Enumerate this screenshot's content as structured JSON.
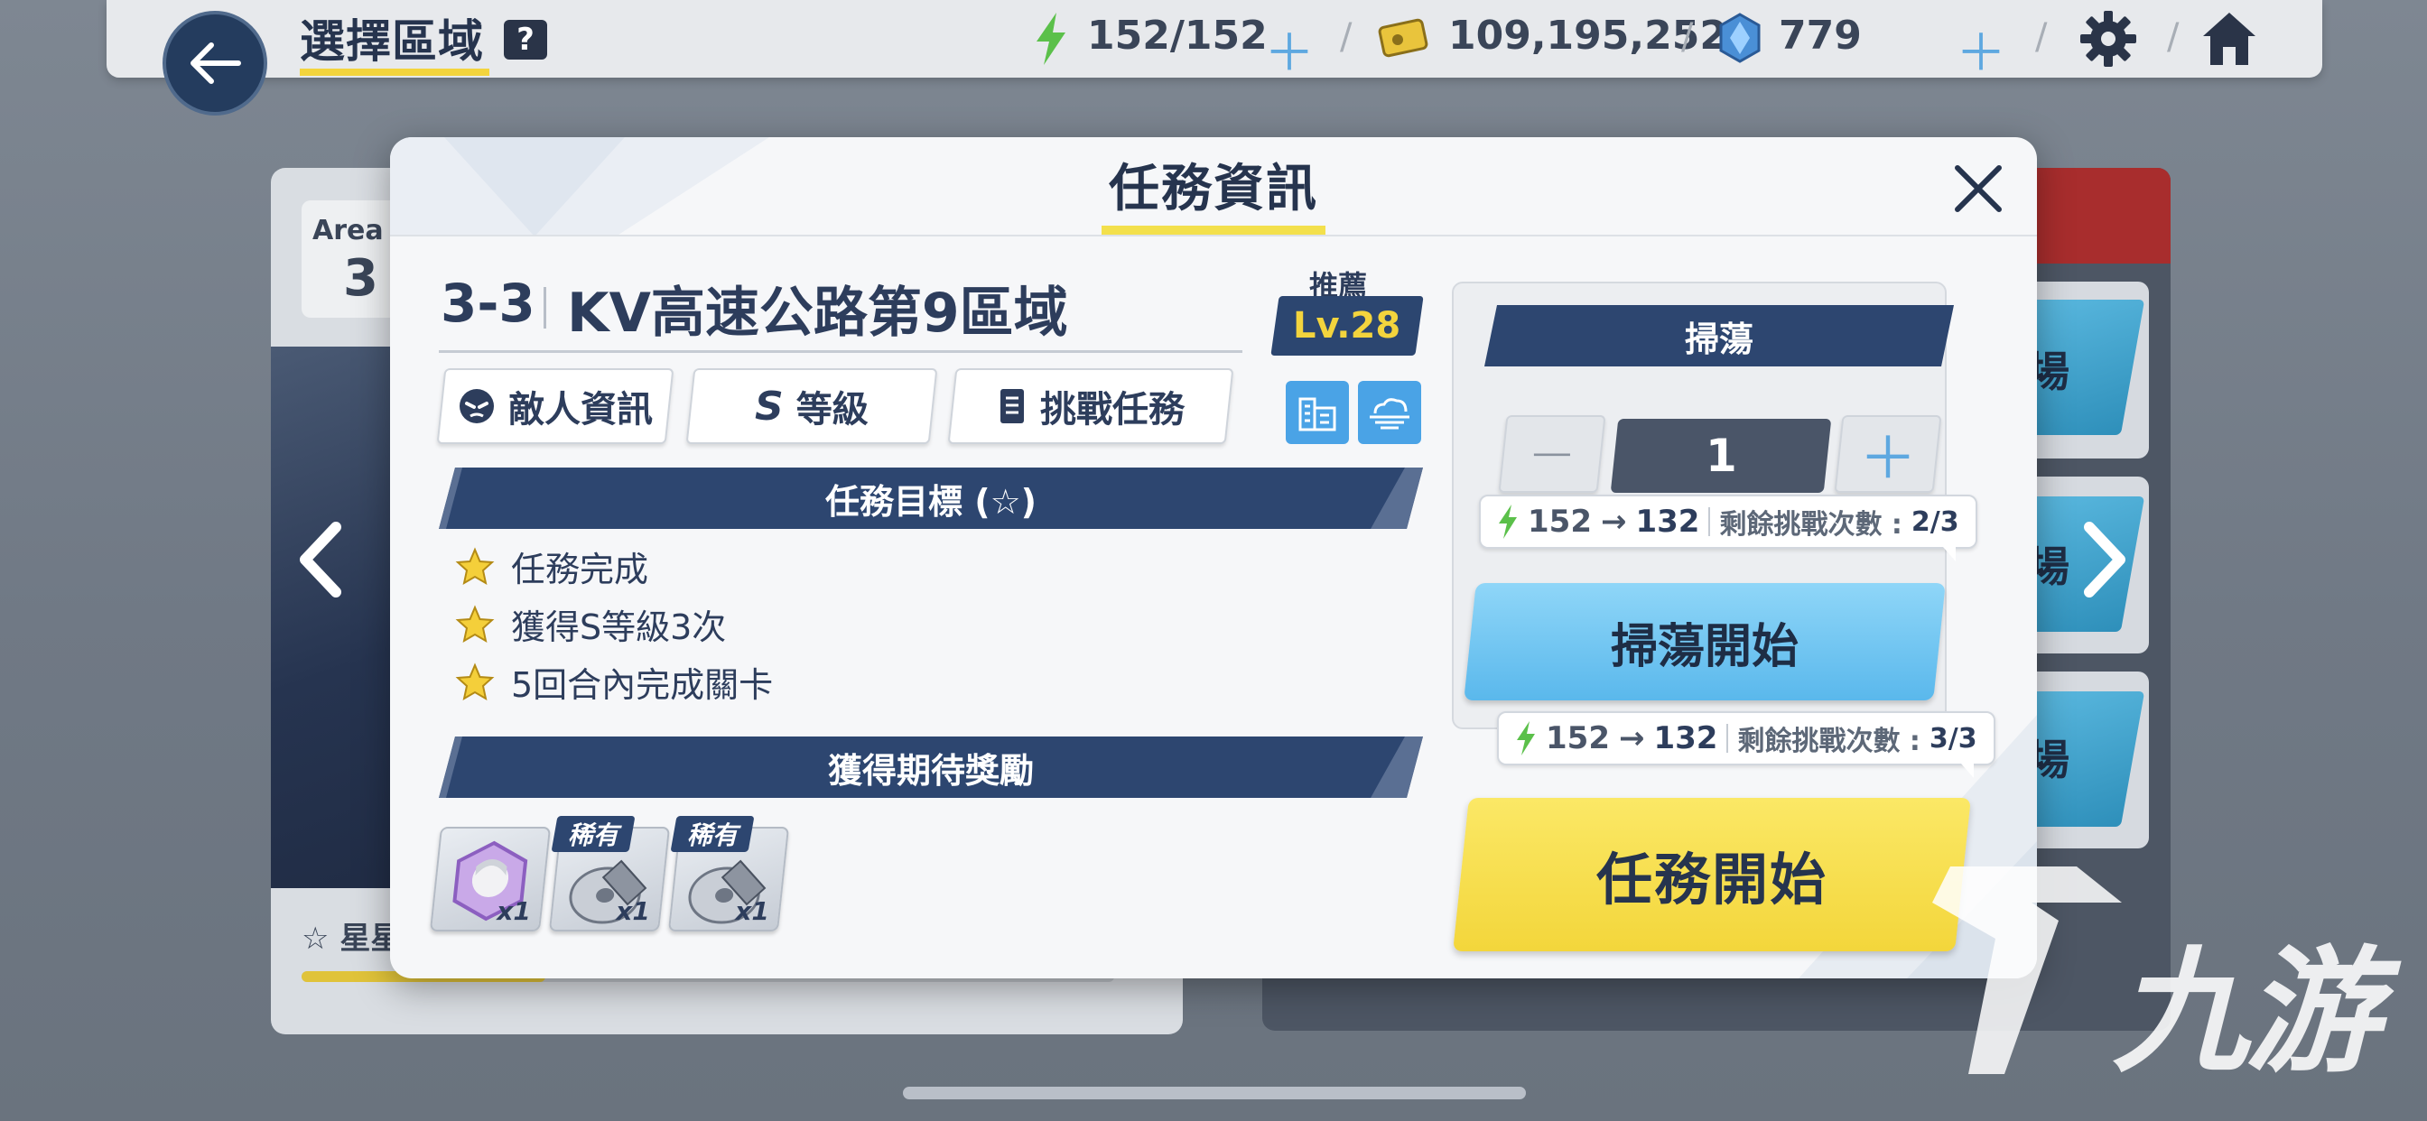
{
  "header": {
    "title": "選擇區域",
    "help_icon": "?",
    "stamina": "152/152",
    "credits": "109,195,252",
    "gems": "779"
  },
  "background": {
    "area_label": "Area",
    "area_number": "3",
    "star_text": "星星",
    "card_text": "場"
  },
  "modal": {
    "title": "任務資訊",
    "stage_code": "3-3",
    "stage_name": "KV高速公路第9區域",
    "recommend_label": "推薦",
    "recommend_level": "Lv.28",
    "tabs": [
      {
        "label": "敵人資訊"
      },
      {
        "label": "等級",
        "prefix": "S"
      },
      {
        "label": "挑戰任務"
      }
    ],
    "goals_title": "任務目標 (☆)",
    "goals": [
      "任務完成",
      "獲得S等級3次",
      "5回合內完成關卡"
    ],
    "rewards_title": "獲得期待獎勵",
    "rewards": [
      {
        "qty": "x1",
        "rarity": ""
      },
      {
        "qty": "x1",
        "rarity": "稀有"
      },
      {
        "qty": "x1",
        "rarity": "稀有"
      }
    ]
  },
  "sweep": {
    "title": "掃蕩",
    "count": "1",
    "ap_from": "152",
    "ap_to": "132",
    "remaining_label": "剩餘挑戰次數 :",
    "remaining": "2/3",
    "start_label": "掃蕩開始"
  },
  "mission": {
    "ap_from": "152",
    "ap_to": "132",
    "remaining_label": "剩餘挑戰次數 :",
    "remaining": "3/3",
    "start_label": "任務開始"
  },
  "watermark": "九游",
  "colors": {
    "navy": "#2d4670",
    "accent_yellow": "#f3d43d",
    "sweep_blue": "#5ab8ec",
    "stamina_green": "#5bc04a"
  }
}
